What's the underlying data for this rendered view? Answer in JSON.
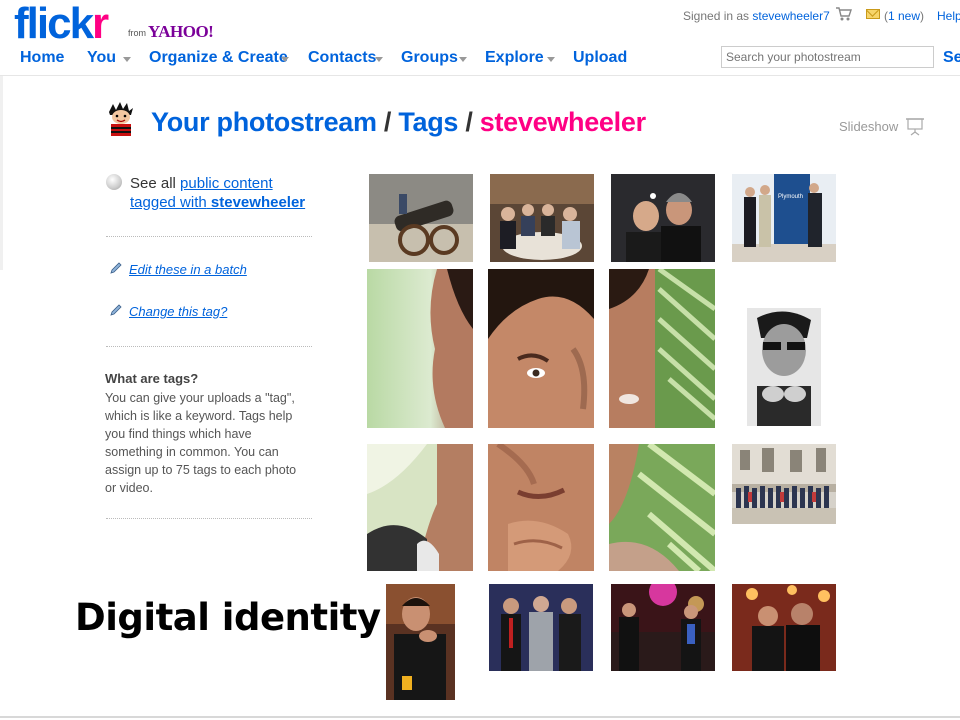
{
  "header": {
    "logo_part1": "flick",
    "logo_part2": "r",
    "logo_from": "from",
    "logo_yahoo": "YAHOO!",
    "signed_in_prefix": "Signed in as",
    "username": "stevewheeler7",
    "messages_open": "(",
    "messages_count": "1 new",
    "messages_close": ")",
    "help": "Help",
    "search_placeholder": "Search your photostream",
    "search_button_cut": "Se"
  },
  "nav": {
    "home": "Home",
    "you": "You",
    "organize": "Organize & Create",
    "contacts": "Contacts",
    "groups": "Groups",
    "explore": "Explore",
    "upload": "Upload"
  },
  "page": {
    "title_part1": "Your photostream",
    "title_sep1": "/",
    "title_part2": "Tags",
    "title_sep2": "/",
    "title_tag": "stevewheeler",
    "slideshow": "Slideshow"
  },
  "sidebar": {
    "see_all_prefix": "See all",
    "see_all_link1": "public content",
    "see_all_link2_prefix": "tagged with",
    "see_all_tag": "stevewheeler",
    "edit_batch": "Edit these in a batch",
    "change_tag": "Change this tag?",
    "what_heading": "What are tags?",
    "what_body": "You can give your uploads a \"tag\", which is like a keyword. Tags help you find things which have something in common. You can assign up to 75 tags to each photo or video."
  },
  "caption": "Digital identity",
  "colors": {
    "flickr_blue": "#0063dc",
    "flickr_pink": "#ff0084",
    "yahoo_purple": "#7b0099"
  }
}
